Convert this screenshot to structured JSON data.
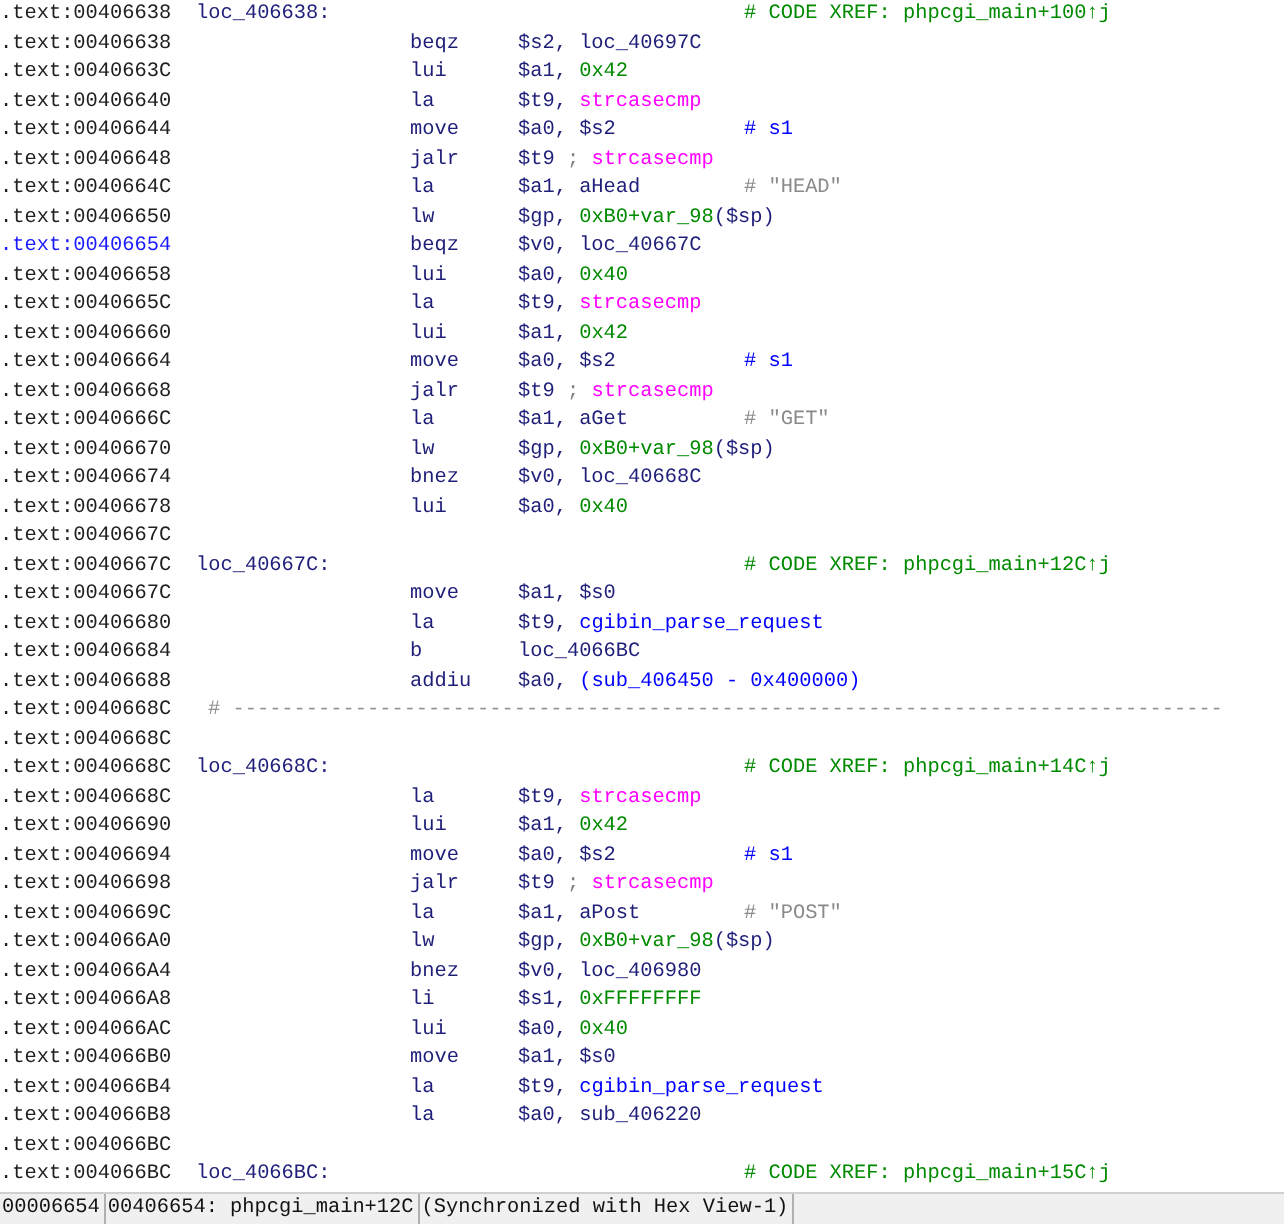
{
  "listing": [
    {
      "address": ".text:00406638",
      "selected": false,
      "kind": "label",
      "label": "loc_406638:",
      "comment": {
        "kind": "xref",
        "text": "# CODE XREF: phpcgi_main+100↑j"
      }
    },
    {
      "address": ".text:00406638",
      "selected": false,
      "kind": "insn",
      "mnemonic": "beqz",
      "operands": [
        {
          "kind": "plain",
          "text": "$s2, loc_40697C"
        }
      ]
    },
    {
      "address": ".text:0040663C",
      "selected": false,
      "kind": "insn",
      "mnemonic": "lui",
      "operands": [
        {
          "kind": "plain",
          "text": "$a1, "
        },
        {
          "kind": "num",
          "text": "0x42"
        }
      ]
    },
    {
      "address": ".text:00406640",
      "selected": false,
      "kind": "insn",
      "mnemonic": "la",
      "operands": [
        {
          "kind": "plain",
          "text": "$t9, "
        },
        {
          "kind": "import",
          "text": "strcasecmp"
        }
      ]
    },
    {
      "address": ".text:00406644",
      "selected": false,
      "kind": "insn",
      "mnemonic": "move",
      "operands": [
        {
          "kind": "plain",
          "text": "$a0, $s2"
        }
      ],
      "comment": {
        "kind": "note",
        "text": "# s1"
      }
    },
    {
      "address": ".text:00406648",
      "selected": false,
      "kind": "insn",
      "mnemonic": "jalr",
      "operands": [
        {
          "kind": "plain",
          "text": "$t9 "
        },
        {
          "kind": "sep",
          "text": "; "
        },
        {
          "kind": "import",
          "text": "strcasecmp"
        }
      ]
    },
    {
      "address": ".text:0040664C",
      "selected": false,
      "kind": "insn",
      "mnemonic": "la",
      "operands": [
        {
          "kind": "plain",
          "text": "$a1, aHead"
        }
      ],
      "comment": {
        "kind": "string",
        "text": "# \"HEAD\""
      }
    },
    {
      "address": ".text:00406650",
      "selected": false,
      "kind": "insn",
      "mnemonic": "lw",
      "operands": [
        {
          "kind": "plain",
          "text": "$gp, "
        },
        {
          "kind": "num",
          "text": "0xB0+var_98"
        },
        {
          "kind": "plain",
          "text": "($sp)"
        }
      ]
    },
    {
      "address": ".text:00406654",
      "selected": true,
      "kind": "insn",
      "mnemonic": "beqz",
      "operands": [
        {
          "kind": "plain",
          "text": "$v0, loc_40667C"
        }
      ]
    },
    {
      "address": ".text:00406658",
      "selected": false,
      "kind": "insn",
      "mnemonic": "lui",
      "operands": [
        {
          "kind": "plain",
          "text": "$a0, "
        },
        {
          "kind": "num",
          "text": "0x40"
        }
      ]
    },
    {
      "address": ".text:0040665C",
      "selected": false,
      "kind": "insn",
      "mnemonic": "la",
      "operands": [
        {
          "kind": "plain",
          "text": "$t9, "
        },
        {
          "kind": "import",
          "text": "strcasecmp"
        }
      ]
    },
    {
      "address": ".text:00406660",
      "selected": false,
      "kind": "insn",
      "mnemonic": "lui",
      "operands": [
        {
          "kind": "plain",
          "text": "$a1, "
        },
        {
          "kind": "num",
          "text": "0x42"
        }
      ]
    },
    {
      "address": ".text:00406664",
      "selected": false,
      "kind": "insn",
      "mnemonic": "move",
      "operands": [
        {
          "kind": "plain",
          "text": "$a0, $s2"
        }
      ],
      "comment": {
        "kind": "note",
        "text": "# s1"
      }
    },
    {
      "address": ".text:00406668",
      "selected": false,
      "kind": "insn",
      "mnemonic": "jalr",
      "operands": [
        {
          "kind": "plain",
          "text": "$t9 "
        },
        {
          "kind": "sep",
          "text": "; "
        },
        {
          "kind": "import",
          "text": "strcasecmp"
        }
      ]
    },
    {
      "address": ".text:0040666C",
      "selected": false,
      "kind": "insn",
      "mnemonic": "la",
      "operands": [
        {
          "kind": "plain",
          "text": "$a1, aGet"
        }
      ],
      "comment": {
        "kind": "string",
        "text": "# \"GET\""
      }
    },
    {
      "address": ".text:00406670",
      "selected": false,
      "kind": "insn",
      "mnemonic": "lw",
      "operands": [
        {
          "kind": "plain",
          "text": "$gp, "
        },
        {
          "kind": "num",
          "text": "0xB0+var_98"
        },
        {
          "kind": "plain",
          "text": "($sp)"
        }
      ]
    },
    {
      "address": ".text:00406674",
      "selected": false,
      "kind": "insn",
      "mnemonic": "bnez",
      "operands": [
        {
          "kind": "plain",
          "text": "$v0, loc_40668C"
        }
      ]
    },
    {
      "address": ".text:00406678",
      "selected": false,
      "kind": "insn",
      "mnemonic": "lui",
      "operands": [
        {
          "kind": "plain",
          "text": "$a0, "
        },
        {
          "kind": "num",
          "text": "0x40"
        }
      ]
    },
    {
      "address": ".text:0040667C",
      "selected": false,
      "kind": "blank"
    },
    {
      "address": ".text:0040667C",
      "selected": false,
      "kind": "label",
      "label": "loc_40667C:",
      "comment": {
        "kind": "xref",
        "text": "# CODE XREF: phpcgi_main+12C↑j"
      }
    },
    {
      "address": ".text:0040667C",
      "selected": false,
      "kind": "insn",
      "mnemonic": "move",
      "operands": [
        {
          "kind": "plain",
          "text": "$a1, $s0"
        }
      ]
    },
    {
      "address": ".text:00406680",
      "selected": false,
      "kind": "insn",
      "mnemonic": "la",
      "operands": [
        {
          "kind": "plain",
          "text": "$t9, "
        },
        {
          "kind": "func",
          "text": "cgibin_parse_request"
        }
      ]
    },
    {
      "address": ".text:00406684",
      "selected": false,
      "kind": "insn",
      "mnemonic": "b",
      "operands": [
        {
          "kind": "plain",
          "text": "loc_4066BC"
        }
      ]
    },
    {
      "address": ".text:00406688",
      "selected": false,
      "kind": "insn",
      "mnemonic": "addiu",
      "operands": [
        {
          "kind": "plain",
          "text": "$a0, "
        },
        {
          "kind": "func",
          "text": "(sub_406450 - 0x400000)"
        }
      ]
    },
    {
      "address": ".text:0040668C",
      "selected": false,
      "kind": "separator",
      "text": "# ---------------------------------------------------------------------------------"
    },
    {
      "address": ".text:0040668C",
      "selected": false,
      "kind": "blank"
    },
    {
      "address": ".text:0040668C",
      "selected": false,
      "kind": "label",
      "label": "loc_40668C:",
      "comment": {
        "kind": "xref",
        "text": "# CODE XREF: phpcgi_main+14C↑j"
      }
    },
    {
      "address": ".text:0040668C",
      "selected": false,
      "kind": "insn",
      "mnemonic": "la",
      "operands": [
        {
          "kind": "plain",
          "text": "$t9, "
        },
        {
          "kind": "import",
          "text": "strcasecmp"
        }
      ]
    },
    {
      "address": ".text:00406690",
      "selected": false,
      "kind": "insn",
      "mnemonic": "lui",
      "operands": [
        {
          "kind": "plain",
          "text": "$a1, "
        },
        {
          "kind": "num",
          "text": "0x42"
        }
      ]
    },
    {
      "address": ".text:00406694",
      "selected": false,
      "kind": "insn",
      "mnemonic": "move",
      "operands": [
        {
          "kind": "plain",
          "text": "$a0, $s2"
        }
      ],
      "comment": {
        "kind": "note",
        "text": "# s1"
      }
    },
    {
      "address": ".text:00406698",
      "selected": false,
      "kind": "insn",
      "mnemonic": "jalr",
      "operands": [
        {
          "kind": "plain",
          "text": "$t9 "
        },
        {
          "kind": "sep",
          "text": "; "
        },
        {
          "kind": "import",
          "text": "strcasecmp"
        }
      ]
    },
    {
      "address": ".text:0040669C",
      "selected": false,
      "kind": "insn",
      "mnemonic": "la",
      "operands": [
        {
          "kind": "plain",
          "text": "$a1, aPost"
        }
      ],
      "comment": {
        "kind": "string",
        "text": "# \"POST\""
      }
    },
    {
      "address": ".text:004066A0",
      "selected": false,
      "kind": "insn",
      "mnemonic": "lw",
      "operands": [
        {
          "kind": "plain",
          "text": "$gp, "
        },
        {
          "kind": "num",
          "text": "0xB0+var_98"
        },
        {
          "kind": "plain",
          "text": "($sp)"
        }
      ]
    },
    {
      "address": ".text:004066A4",
      "selected": false,
      "kind": "insn",
      "mnemonic": "bnez",
      "operands": [
        {
          "kind": "plain",
          "text": "$v0, loc_406980"
        }
      ]
    },
    {
      "address": ".text:004066A8",
      "selected": false,
      "kind": "insn",
      "mnemonic": "li",
      "operands": [
        {
          "kind": "plain",
          "text": "$s1, "
        },
        {
          "kind": "num",
          "text": "0xFFFFFFFF"
        }
      ]
    },
    {
      "address": ".text:004066AC",
      "selected": false,
      "kind": "insn",
      "mnemonic": "lui",
      "operands": [
        {
          "kind": "plain",
          "text": "$a0, "
        },
        {
          "kind": "num",
          "text": "0x40"
        }
      ]
    },
    {
      "address": ".text:004066B0",
      "selected": false,
      "kind": "insn",
      "mnemonic": "move",
      "operands": [
        {
          "kind": "plain",
          "text": "$a1, $s0"
        }
      ]
    },
    {
      "address": ".text:004066B4",
      "selected": false,
      "kind": "insn",
      "mnemonic": "la",
      "operands": [
        {
          "kind": "plain",
          "text": "$t9, "
        },
        {
          "kind": "func",
          "text": "cgibin_parse_request"
        }
      ]
    },
    {
      "address": ".text:004066B8",
      "selected": false,
      "kind": "insn",
      "mnemonic": "la",
      "operands": [
        {
          "kind": "plain",
          "text": "$a0, sub_406220"
        }
      ]
    },
    {
      "address": ".text:004066BC",
      "selected": false,
      "kind": "blank"
    },
    {
      "address": ".text:004066BC",
      "selected": false,
      "kind": "label",
      "label": "loc_4066BC:",
      "comment": {
        "kind": "xref",
        "text": "# CODE XREF: phpcgi_main+15C↑j"
      }
    }
  ],
  "status_bar": [
    "00006654",
    "00406654: phpcgi_main+12C",
    "(Synchronized with Hex View-1)"
  ]
}
